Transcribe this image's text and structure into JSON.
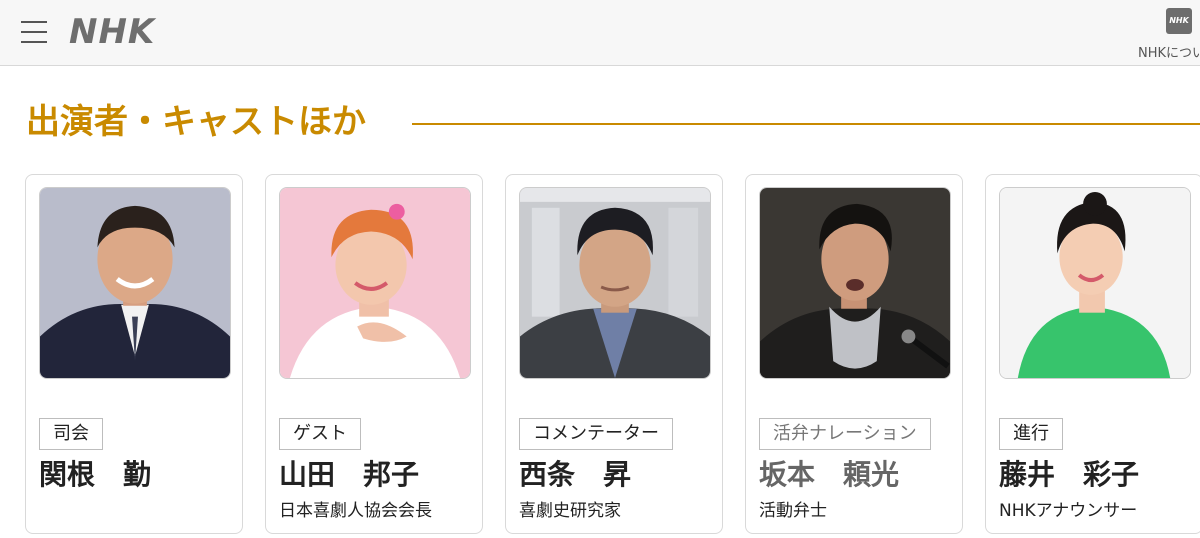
{
  "header": {
    "logo": "NHK",
    "about_icon_text": "NHK",
    "about_label": "NHKについて"
  },
  "section": {
    "title": "出演者・キャストほか"
  },
  "colors": {
    "accent": "#c98a00",
    "header_bg": "#f7f7f7"
  },
  "cast": [
    {
      "role": "司会",
      "name": "関根　勤",
      "desc": ""
    },
    {
      "role": "ゲスト",
      "name": "山田　邦子",
      "desc": "日本喜劇人協会会長"
    },
    {
      "role": "コメンテーター",
      "name": "西条　昇",
      "desc": "喜劇史研究家"
    },
    {
      "role": "活弁ナレーション",
      "name": "坂本　頼光",
      "desc": "活動弁士"
    },
    {
      "role": "進行",
      "name": "藤井　彩子",
      "desc": "NHKアナウンサー"
    }
  ]
}
